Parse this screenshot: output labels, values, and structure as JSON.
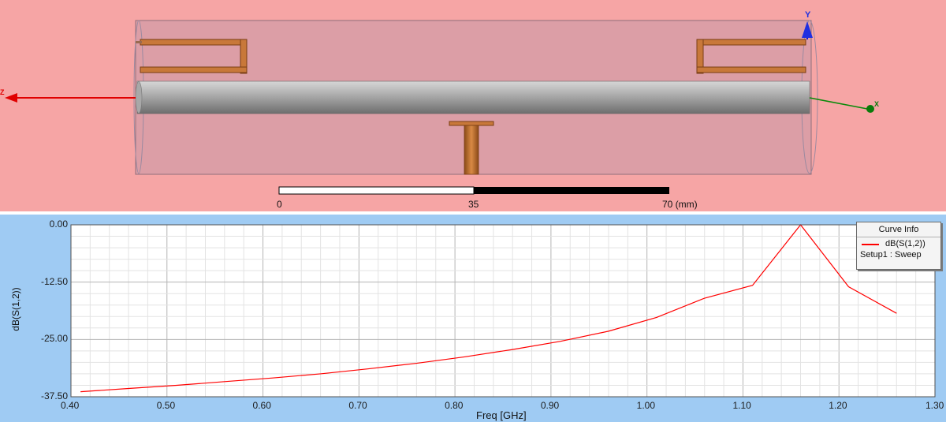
{
  "viewport": {
    "background": "#f6a5a5",
    "axis_labels": {
      "y": "Y",
      "z": "Z",
      "x": "X"
    },
    "scale_bar": {
      "labels": [
        "0",
        "35",
        "70 (mm)"
      ]
    }
  },
  "chart_data": {
    "type": "line",
    "xlabel": "Freq [GHz]",
    "ylabel": "dB(S(1,2))",
    "xlim": [
      0.4,
      1.3
    ],
    "ylim": [
      -37.5,
      0.0
    ],
    "x_ticks": [
      "0.40",
      "0.50",
      "0.60",
      "0.70",
      "0.80",
      "0.90",
      "1.00",
      "1.10",
      "1.20",
      "1.30"
    ],
    "y_ticks": [
      "0.00",
      "-12.50",
      "-25.00",
      "-37.50"
    ],
    "grid": true,
    "legend": {
      "title": "Curve Info",
      "entry_name": "dB(S(1,2))",
      "entry_setup": "Setup1 : Sweep",
      "placement": "top-right"
    },
    "series": [
      {
        "name": "dB(S(1,2))",
        "color": "#ff0000",
        "x": [
          0.41,
          0.46,
          0.51,
          0.56,
          0.61,
          0.66,
          0.71,
          0.76,
          0.81,
          0.86,
          0.91,
          0.96,
          1.01,
          1.06,
          1.11,
          1.16,
          1.21,
          1.26
        ],
        "y": [
          -36.4,
          -35.7,
          -35.0,
          -34.2,
          -33.4,
          -32.5,
          -31.4,
          -30.2,
          -28.8,
          -27.2,
          -25.4,
          -23.2,
          -20.2,
          -16.0,
          -13.2,
          0.0,
          -13.5,
          -19.3
        ]
      }
    ]
  }
}
